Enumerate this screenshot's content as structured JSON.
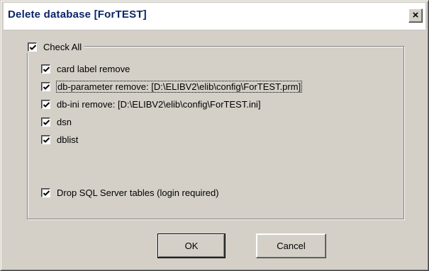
{
  "window": {
    "title": "Delete database [ForTEST]",
    "close_glyph": "×"
  },
  "group": {
    "check_all": {
      "label": "Check All",
      "checked": true
    }
  },
  "options": [
    {
      "label": "card label remove",
      "checked": true
    },
    {
      "label": "db-parameter remove: [D:\\ELIBV2\\elib\\config\\ForTEST.prm]",
      "checked": true
    },
    {
      "label": "db-ini remove: [D:\\ELIBV2\\elib\\config\\ForTEST.ini]",
      "checked": true
    },
    {
      "label": "dsn",
      "checked": true
    },
    {
      "label": "dblist",
      "checked": true
    }
  ],
  "drop_tables": {
    "label": "Drop SQL Server tables (login required)",
    "checked": true
  },
  "buttons": {
    "ok_label": "OK",
    "cancel_label": "Cancel"
  },
  "colors": {
    "title_text": "#0a246a",
    "dialog_face": "#d4d0c8"
  }
}
